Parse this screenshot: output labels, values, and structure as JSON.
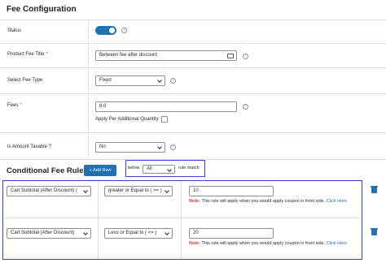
{
  "fee_config": {
    "title": "Fee Configuration",
    "status_label": "Status",
    "status_enabled": true,
    "product_fee_title_label": "Product Fee Title",
    "product_fee_title_value": "Between fee after discount",
    "required_mark": "*",
    "select_fee_type_label": "Select Fee Type",
    "fee_type_value": "Fixed",
    "fees_label": "Fees",
    "fees_value": "8.0",
    "apply_per_qty_label": "Apply Per Additional Quantity",
    "apply_per_qty_checked": false,
    "amount_taxable_label": "Is Amount Taxable ?",
    "amount_taxable_value": "No",
    "help_glyph": "?"
  },
  "conditional": {
    "title": "Conditional Fee Rule",
    "add_row_label": "+ Add Row",
    "below_label": "below",
    "match_value": "All",
    "rule_match_label": "rule match",
    "rules": [
      {
        "condition": "Cart Subtotal (After Discount) (",
        "operator": "greater or Equal to ( >= )",
        "value": "10",
        "note_prefix": "Note:",
        "note_text": " This rule will apply when you would apply coupon in front side. ",
        "note_link": "Click Here"
      },
      {
        "condition": "Cart Subtotal (After Discount)",
        "operator": "Less or Equal to ( <= )",
        "value": "20",
        "note_prefix": "Note:",
        "note_text": " This rule will apply when you would apply coupon in front side. ",
        "note_link": "Click Here"
      }
    ]
  },
  "colors": {
    "accent": "#2271b1",
    "highlight_box": "#3c3fd6",
    "required": "#d63638"
  }
}
